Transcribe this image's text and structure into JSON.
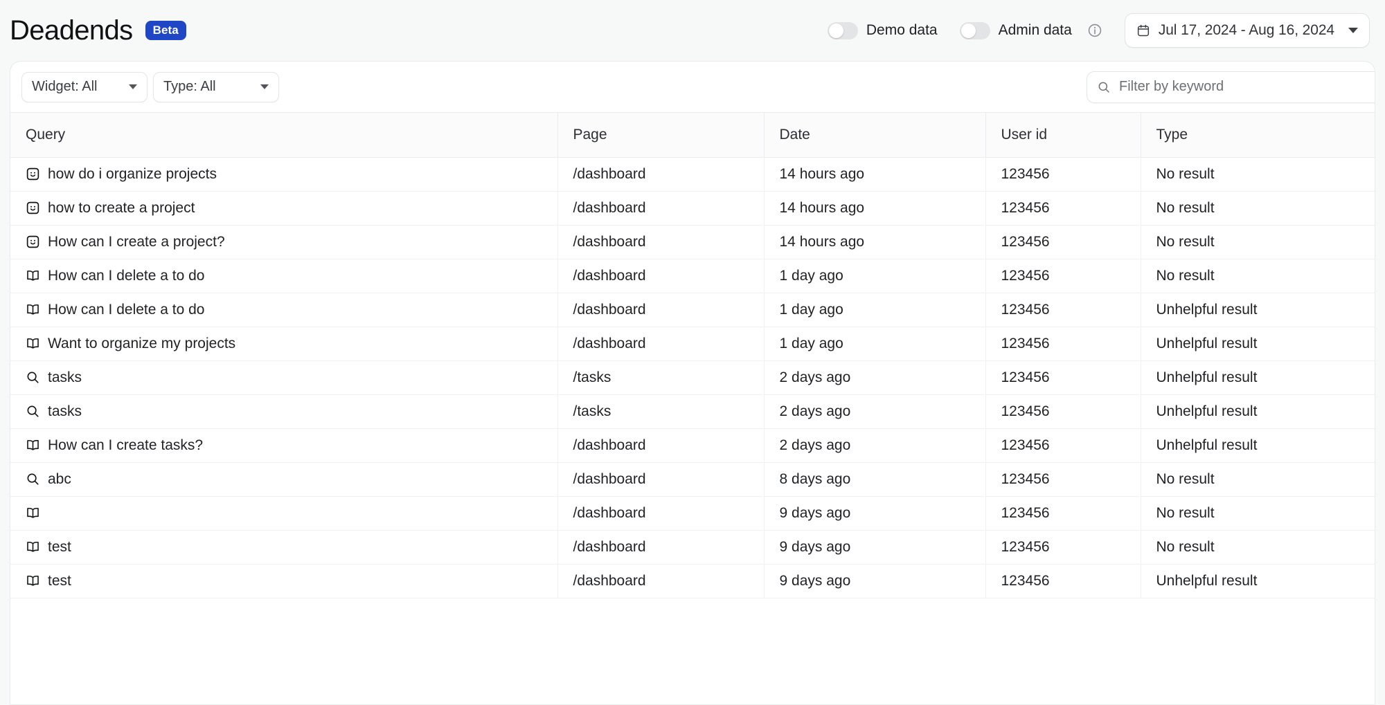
{
  "header": {
    "title": "Deadends",
    "badge": "Beta",
    "toggles": [
      {
        "label": "Demo data",
        "state": "off",
        "icon": "toggle-switch"
      },
      {
        "label": "Admin data",
        "state": "off",
        "icon": "toggle-switch",
        "info_icon": "info-icon"
      }
    ],
    "date_range": {
      "icon": "calendar-icon",
      "value": "Jul 17, 2024 - Aug 16, 2024",
      "caret": "chevron-down-icon"
    }
  },
  "filters": {
    "widget": {
      "label": "Widget: All",
      "caret": "chevron-down-icon"
    },
    "type": {
      "label": "Type: All",
      "caret": "chevron-down-icon"
    },
    "search": {
      "icon": "search-icon",
      "value": "",
      "placeholder": "Filter by keyword"
    }
  },
  "table": {
    "columns": [
      "Query",
      "Page",
      "Date",
      "User id",
      "Type"
    ],
    "rows": [
      {
        "icon": "smiley-square-icon",
        "query": "how do i organize projects",
        "page": "/dashboard",
        "date": "14 hours ago",
        "user_id": "123456",
        "type": "No result"
      },
      {
        "icon": "smiley-square-icon",
        "query": "how to create a project",
        "page": "/dashboard",
        "date": "14 hours ago",
        "user_id": "123456",
        "type": "No result"
      },
      {
        "icon": "smiley-square-icon",
        "query": "How can I create a project?",
        "page": "/dashboard",
        "date": "14 hours ago",
        "user_id": "123456",
        "type": "No result"
      },
      {
        "icon": "book-icon",
        "query": "How can I delete a to do",
        "page": "/dashboard",
        "date": "1 day ago",
        "user_id": "123456",
        "type": "No result"
      },
      {
        "icon": "book-icon",
        "query": "How can I delete a to do",
        "page": "/dashboard",
        "date": "1 day ago",
        "user_id": "123456",
        "type": "Unhelpful result"
      },
      {
        "icon": "book-icon",
        "query": "Want to organize my projects",
        "page": "/dashboard",
        "date": "1 day ago",
        "user_id": "123456",
        "type": "Unhelpful result"
      },
      {
        "icon": "search-icon",
        "query": "tasks",
        "page": "/tasks",
        "date": "2 days ago",
        "user_id": "123456",
        "type": "Unhelpful result"
      },
      {
        "icon": "search-icon",
        "query": "tasks",
        "page": "/tasks",
        "date": "2 days ago",
        "user_id": "123456",
        "type": "Unhelpful result"
      },
      {
        "icon": "book-icon",
        "query": "How can I create tasks?",
        "page": "/dashboard",
        "date": "2 days ago",
        "user_id": "123456",
        "type": "Unhelpful result"
      },
      {
        "icon": "search-icon",
        "query": "abc",
        "page": "/dashboard",
        "date": "8 days ago",
        "user_id": "123456",
        "type": "No result"
      },
      {
        "icon": "book-icon",
        "query": "",
        "page": "/dashboard",
        "date": "9 days ago",
        "user_id": "123456",
        "type": "No result"
      },
      {
        "icon": "book-icon",
        "query": "test",
        "page": "/dashboard",
        "date": "9 days ago",
        "user_id": "123456",
        "type": "No result"
      },
      {
        "icon": "book-icon",
        "query": "test",
        "page": "/dashboard",
        "date": "9 days ago",
        "user_id": "123456",
        "type": "Unhelpful result"
      }
    ]
  },
  "colors": {
    "accent": "#1f46c4",
    "page_bg": "#f7f8f8",
    "panel_bg": "#ffffff",
    "border": "#e9eaec",
    "text": "#1f2125"
  }
}
